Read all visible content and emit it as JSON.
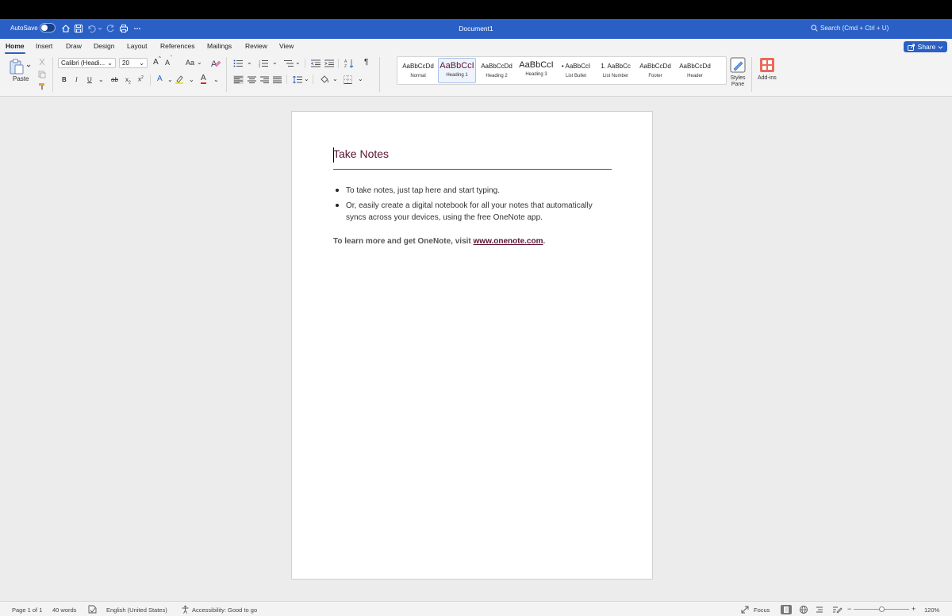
{
  "titlebar": {
    "autosave_label": "AutoSave",
    "document_title": "Document1",
    "search_placeholder": "Search (Cmd + Ctrl + U)"
  },
  "tabs": [
    {
      "label": "Home",
      "active": true
    },
    {
      "label": "Insert"
    },
    {
      "label": "Draw"
    },
    {
      "label": "Design"
    },
    {
      "label": "Layout"
    },
    {
      "label": "References"
    },
    {
      "label": "Mailings"
    },
    {
      "label": "Review"
    },
    {
      "label": "View"
    }
  ],
  "share_label": "Share",
  "ribbon": {
    "paste_label": "Paste",
    "font_name": "Calibri (Headi...",
    "font_size": "20",
    "grow_font": "A",
    "shrink_font": "A",
    "change_case": "Aa",
    "bold": "B",
    "italic": "I",
    "underline": "U",
    "strikethrough": "ab",
    "subscript": "x",
    "superscript": "x",
    "text_effects": "A",
    "font_color": "A",
    "styles": [
      {
        "sample": "AaBbCcDd",
        "name": "Normal"
      },
      {
        "sample": "AaBbCcI",
        "name": "Heading 1"
      },
      {
        "sample": "AaBbCcDd",
        "name": "Heading 2"
      },
      {
        "sample": "AaBbCcI",
        "name": "Heading 3"
      },
      {
        "sample": "• AaBbCcI",
        "name": "List Bullet"
      },
      {
        "sample": "1. AaBbCc",
        "name": "List Number"
      },
      {
        "sample": "AaBbCcDd",
        "name": "Footer"
      },
      {
        "sample": "AaBbCcDd",
        "name": "Header"
      }
    ],
    "styles_pane_l1": "Styles",
    "styles_pane_l2": "Pane",
    "addins_label": "Add-ins"
  },
  "document": {
    "heading": "Take Notes",
    "bullets": [
      "To take notes, just tap here and start typing.",
      "Or, easily create a digital notebook for all your notes that automatically",
      "syncs across your devices, using the free OneNote app."
    ],
    "learn_prefix": "To learn more and get OneNote, visit ",
    "learn_link": "www.onenote.com",
    "learn_suffix": "."
  },
  "status": {
    "page": "Page 1 of 1",
    "words": "40 words",
    "language": "English (United States)",
    "accessibility": "Accessibility: Good to go",
    "focus": "Focus",
    "zoom_minus": "−",
    "zoom_plus": "+",
    "zoom": "120%"
  },
  "colors": {
    "brand_blue": "#2a60c6",
    "heading_color": "#5a1432"
  }
}
